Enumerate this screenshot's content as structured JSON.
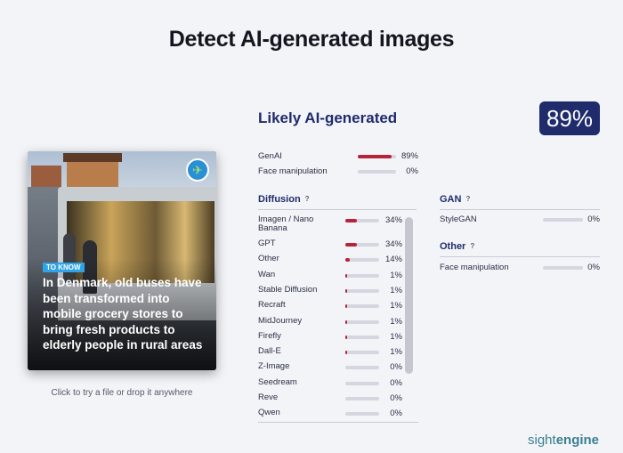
{
  "title": "Detect AI-generated images",
  "image_card": {
    "tag": "TO KNOW",
    "headline": "In Denmark, old buses have been transformed into mobile grocery stores to bring fresh products to elderly people in rural areas",
    "badge_icon": "airplane-globe-icon"
  },
  "upload_hint": "Click to try a file or drop it anywhere",
  "result": {
    "verdict": "Likely AI-generated",
    "score": "89%",
    "summary": [
      {
        "label": "GenAI",
        "pct": "89%",
        "value": 0.89
      },
      {
        "label": "Face manipulation",
        "pct": "0%",
        "value": 0
      }
    ]
  },
  "diffusion": {
    "title": "Diffusion",
    "help": "?",
    "items": [
      {
        "label": "Imagen / Nano Banana",
        "pct": "34%",
        "value": 0.34
      },
      {
        "label": "GPT",
        "pct": "34%",
        "value": 0.34
      },
      {
        "label": "Other",
        "pct": "14%",
        "value": 0.14
      },
      {
        "label": "Wan",
        "pct": "1%",
        "value": 0.01
      },
      {
        "label": "Stable Diffusion",
        "pct": "1%",
        "value": 0.01
      },
      {
        "label": "Recraft",
        "pct": "1%",
        "value": 0.01
      },
      {
        "label": "MidJourney",
        "pct": "1%",
        "value": 0.01
      },
      {
        "label": "Firefly",
        "pct": "1%",
        "value": 0.01
      },
      {
        "label": "Dall-E",
        "pct": "1%",
        "value": 0.01
      },
      {
        "label": "Z-Image",
        "pct": "0%",
        "value": 0
      },
      {
        "label": "Seedream",
        "pct": "0%",
        "value": 0
      },
      {
        "label": "Reve",
        "pct": "0%",
        "value": 0
      },
      {
        "label": "Qwen",
        "pct": "0%",
        "value": 0
      }
    ]
  },
  "gan": {
    "title": "GAN",
    "help": "?",
    "items": [
      {
        "label": "StyleGAN",
        "pct": "0%",
        "value": 0
      }
    ]
  },
  "other": {
    "title": "Other",
    "help": "?",
    "items": [
      {
        "label": "Face manipulation",
        "pct": "0%",
        "value": 0
      }
    ]
  },
  "brand": {
    "part1": "sight",
    "part2": "engine"
  },
  "colors": {
    "accent": "#1f2b6b",
    "bar_fill": "#b8233a",
    "bar_track": "#d4d7df"
  }
}
